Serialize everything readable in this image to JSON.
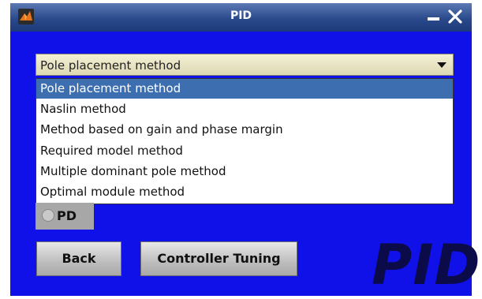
{
  "window": {
    "title": "PID",
    "controls": {
      "minimize_icon": "minimize-icon",
      "close_icon": "close-icon"
    },
    "app_icon": "matlab-icon"
  },
  "method_select": {
    "selected": "Pole placement method",
    "options": [
      "Pole placement method",
      "Naslin method",
      "Method based on gain and phase margin",
      "Required model method",
      "Multiple dominant pole method",
      "Optimal module method"
    ]
  },
  "radio": {
    "label": "PD",
    "checked": false
  },
  "buttons": {
    "back": "Back",
    "tuning": "Controller Tuning"
  },
  "watermark": "PID",
  "colors": {
    "background": "#1010e8",
    "titlebar": "#2a4a8c",
    "selection": "#3d6fb0"
  }
}
